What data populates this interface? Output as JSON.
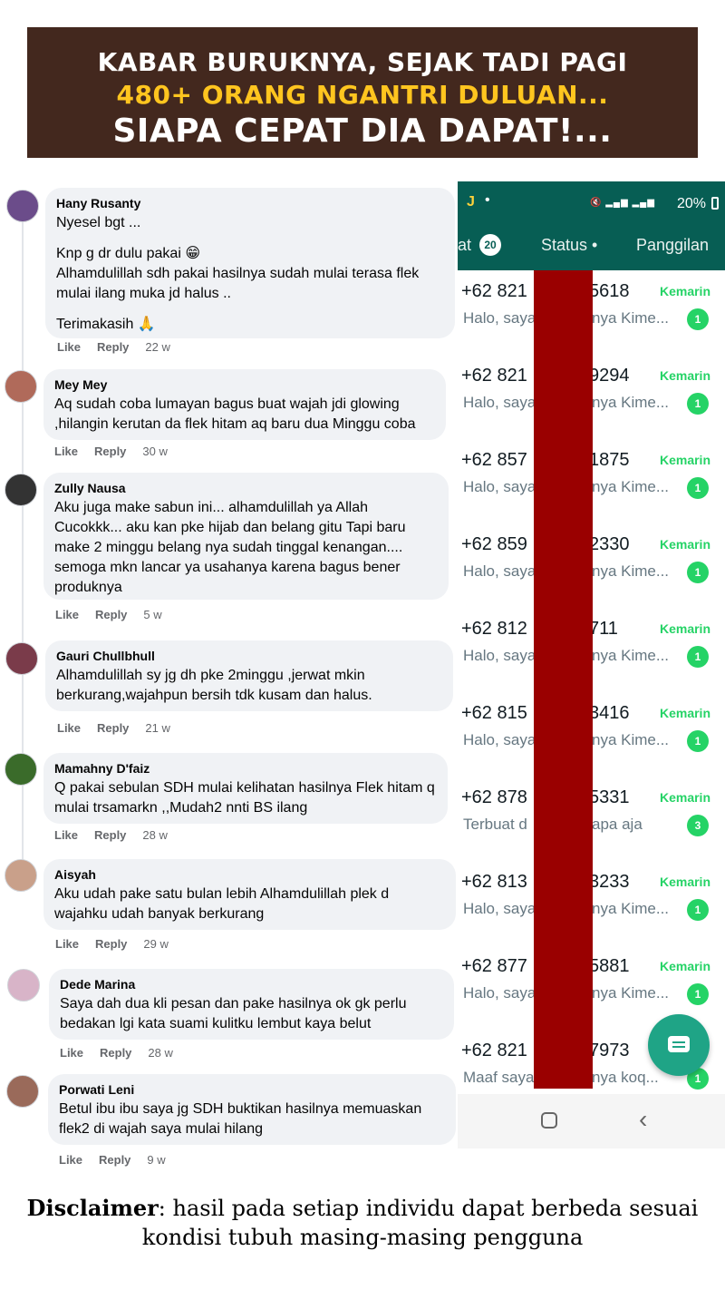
{
  "banner": {
    "line1": "KABAR BURUKNYA, SEJAK TADI PAGI",
    "line2": "480+ ORANG NGANTRI DULUAN...",
    "line3": "SIAPA CEPAT DIA DAPAT!...",
    "color_line2": "#ffc51f",
    "background": "#43281e"
  },
  "comment_actions": {
    "like": "Like",
    "reply": "Reply"
  },
  "comments": [
    {
      "author": "Hany Rusanty",
      "paragraphs": [
        "Nyesel bgt ...",
        "Knp g dr dulu pakai 😁\nAlhamdulillah sdh pakai hasilnya sudah mulai terasa flek mulai ilang muka jd halus ..",
        "Terimakasih 🙏"
      ],
      "time": "22 w"
    },
    {
      "author": "Mey Mey",
      "paragraphs": [
        "Aq sudah coba lumayan bagus buat wajah jdi glowing ,hilangin kerutan da flek hitam aq baru dua Minggu coba"
      ],
      "time": "30 w"
    },
    {
      "author": "Zully Nausa",
      "paragraphs": [
        "Aku juga make sabun ini... alhamdulillah ya Allah Cucokkk... aku kan pke hijab dan belang gitu Tapi baru make 2 minggu belang nya sudah tinggal kenangan.... semoga mkn lancar ya usahanya karena bagus bener produknya"
      ],
      "time": "5 w"
    },
    {
      "author": "Gauri Chullbhull",
      "paragraphs": [
        "Alhamdulillah sy jg dh pke 2minggu ,jerwat mkin berkurang,wajahpun bersih tdk kusam dan halus."
      ],
      "time": "21 w"
    },
    {
      "author": "Mamahny D'faiz",
      "paragraphs": [
        "Q pakai sebulan SDH mulai kelihatan hasilnya Flek hitam q mulai trsamarkn ,,Mudah2 nnti BS ilang"
      ],
      "time": "28 w"
    },
    {
      "author": "Aisyah",
      "paragraphs": [
        "Aku udah pake satu bulan lebih Alhamdulillah plek d wajahku udah banyak berkurang"
      ],
      "time": "29 w"
    },
    {
      "author": "Dede Marina",
      "paragraphs": [
        "Saya dah dua kli pesan dan pake hasilnya ok gk perlu bedakan lgi kata suami kulitku lembut kaya belut"
      ],
      "time": "28 w"
    },
    {
      "author": "Porwati Leni",
      "paragraphs": [
        "Betul ibu ibu saya jg SDH buktikan hasilnya memuaskan flek2 di wajah saya mulai hilang"
      ],
      "time": "9 w"
    }
  ],
  "phone": {
    "status_battery": "20%",
    "status_app_letter": "J",
    "tabs": {
      "chat": "at",
      "chat_badge": "20",
      "status": "Status •",
      "calls": "Panggilan"
    },
    "chats": [
      {
        "number": "+62 821",
        "number_end": "5618",
        "date": "Kemarin",
        "preview": "Halo, saya",
        "preview_end": "nya Kime...",
        "unread": "1"
      },
      {
        "number": "+62 821",
        "number_end": "9294",
        "date": "Kemarin",
        "preview": "Halo, saya",
        "preview_end": "nya Kime...",
        "unread": "1"
      },
      {
        "number": "+62 857",
        "number_end": "1875",
        "date": "Kemarin",
        "preview": "Halo, saya",
        "preview_end": "nya Kime...",
        "unread": "1"
      },
      {
        "number": "+62 859",
        "number_end": "2330",
        "date": "Kemarin",
        "preview": "Halo, saya",
        "preview_end": "nya Kime...",
        "unread": "1"
      },
      {
        "number": "+62 812",
        "number_end": "711",
        "date": "Kemarin",
        "preview": "Halo, saya",
        "preview_end": "nya Kime...",
        "unread": "1"
      },
      {
        "number": "+62 815",
        "number_end": "3416",
        "date": "Kemarin",
        "preview": "Halo, saya",
        "preview_end": "nya Kime...",
        "unread": "1"
      },
      {
        "number": "+62 878",
        "number_end": "5331",
        "date": "Kemarin",
        "preview": "Terbuat d",
        "preview_end": "apa aja",
        "unread": "3"
      },
      {
        "number": "+62 813",
        "number_end": "3233",
        "date": "Kemarin",
        "preview": "Halo, saya",
        "preview_end": "nya Kime...",
        "unread": "1"
      },
      {
        "number": "+62 877",
        "number_end": "5881",
        "date": "Kemarin",
        "preview": "Halo, saya",
        "preview_end": "nya Kime...",
        "unread": "1"
      },
      {
        "number": "+62 821",
        "number_end": "7973",
        "date": "",
        "preview": "Maaf saya",
        "preview_end": "nya koq...",
        "unread": "1"
      }
    ],
    "colors": {
      "header": "#075e54",
      "accent": "#25d366",
      "redaction": "#9a0000",
      "fab": "#1fa486"
    }
  },
  "disclaimer": {
    "label": "Disclaimer",
    "text": ": hasil pada setiap individu dapat berbeda sesuai",
    "text2": "kondisi tubuh masing-masing pengguna"
  }
}
